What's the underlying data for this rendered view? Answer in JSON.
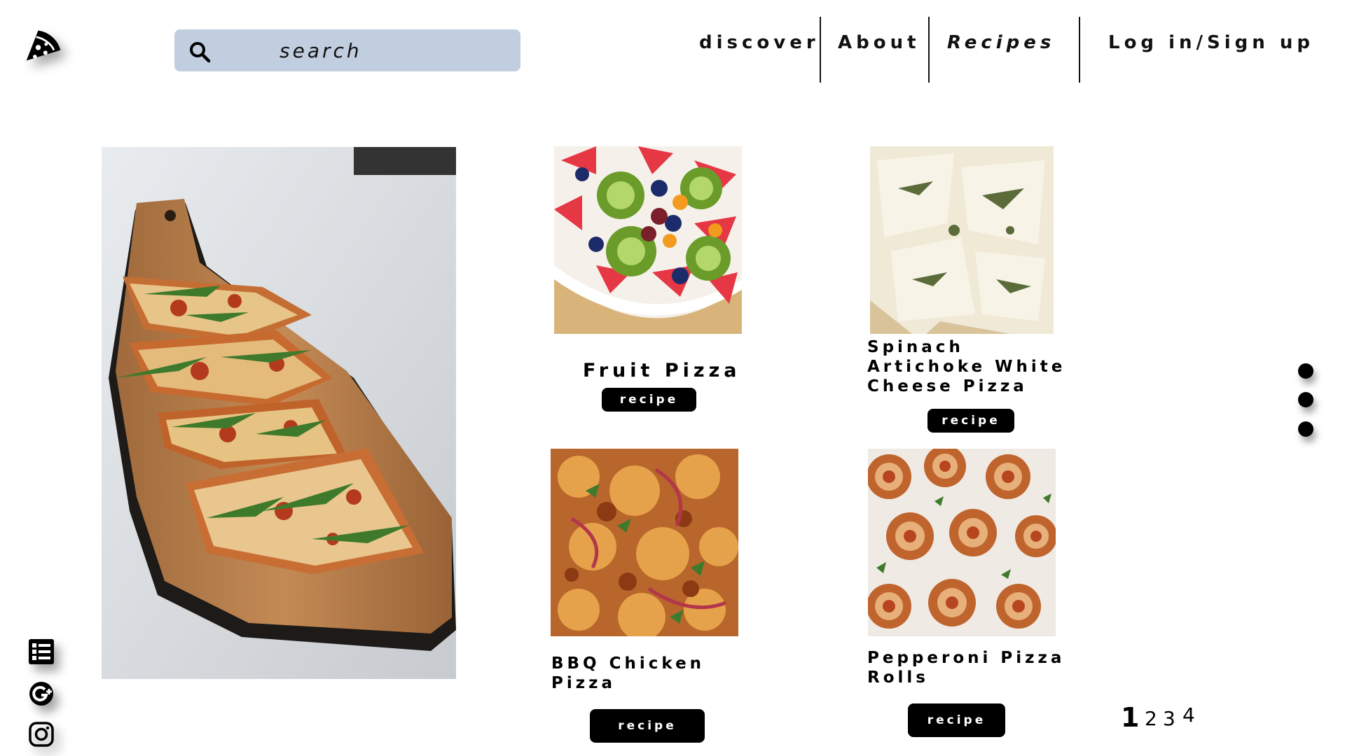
{
  "search": {
    "placeholder": "search"
  },
  "nav": {
    "discover": "discover",
    "about": "About",
    "recipes": "Recipes",
    "login": "Log in/Sign up"
  },
  "cards": [
    {
      "title": "Fruit Pizza",
      "button": "recipe"
    },
    {
      "title": "Spinach Artichoke White Cheese Pizza",
      "button": "recipe"
    },
    {
      "title": "BBQ Chicken Pizza",
      "button": "recipe"
    },
    {
      "title": "Pepperoni Pizza Rolls",
      "button": "recipe"
    }
  ],
  "pagination": [
    "1",
    "2",
    "3",
    "4"
  ],
  "slider": {
    "count": 3
  },
  "icons": {
    "logo": "pizza-slice-icon",
    "search": "search-icon",
    "social": [
      "menu-list-icon",
      "google-plus-icon",
      "instagram-icon"
    ]
  }
}
